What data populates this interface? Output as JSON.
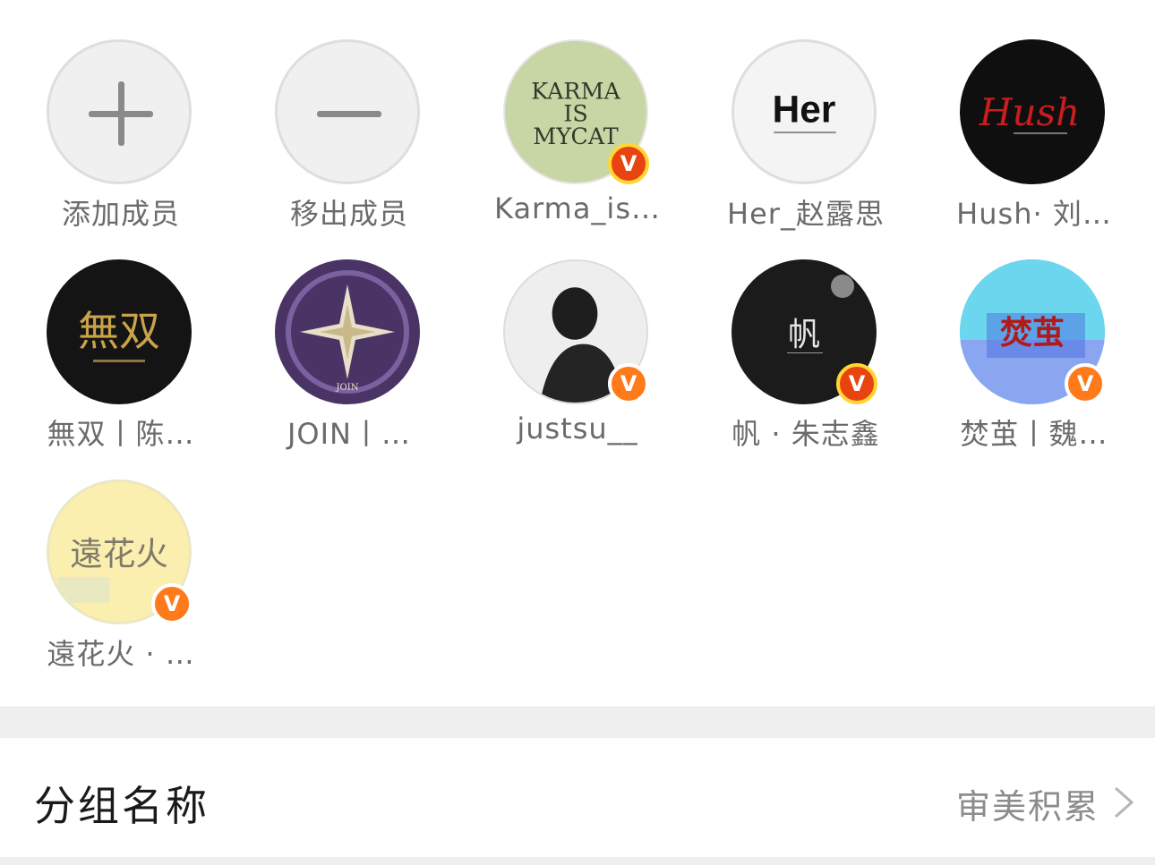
{
  "members": {
    "actions": [
      {
        "label": "添加成员",
        "icon": "plus-icon"
      },
      {
        "label": "移出成员",
        "icon": "minus-icon"
      }
    ],
    "list": [
      {
        "label": "Karma_is…",
        "avatar_text": [
          "KARMA",
          "IS",
          "MYCAT"
        ],
        "verified": "gold"
      },
      {
        "label": "Her_赵露思",
        "avatar_text": [
          "Her"
        ],
        "verified": ""
      },
      {
        "label": "Hush· 刘…",
        "avatar_text": [
          "Hush"
        ],
        "verified": ""
      },
      {
        "label": "無双丨陈…",
        "avatar_text": [
          "無双"
        ],
        "verified": ""
      },
      {
        "label": "JOIN丨…",
        "avatar_text": [
          "JOIN"
        ],
        "verified": ""
      },
      {
        "label": "justsu__",
        "avatar_text": [],
        "verified": "orange"
      },
      {
        "label": "帆 · 朱志鑫",
        "avatar_text": [
          "帆"
        ],
        "verified": "gold"
      },
      {
        "label": "焚茧丨魏…",
        "avatar_text": [
          "焚茧"
        ],
        "verified": "orange"
      },
      {
        "label": "遠花火 · …",
        "avatar_text": [
          "遠花火"
        ],
        "verified": "orange"
      }
    ]
  },
  "group": {
    "title": "分组名称",
    "value": "审美积累"
  },
  "colors": {
    "badge_orange": "#ff7a1a",
    "badge_gold_ring": "#ffd633"
  }
}
